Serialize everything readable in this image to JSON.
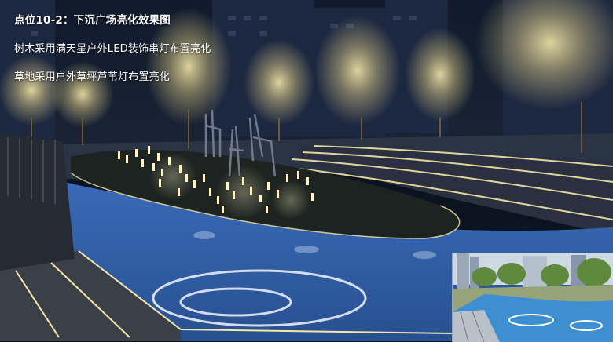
{
  "slide": {
    "title": "点位10-2：下沉广场亮化效果图",
    "lines": [
      "树木采用满天星户外LED装饰串灯布置亮化",
      "草地采用户外草坪芦苇灯布置亮化"
    ]
  },
  "colors": {
    "sky": "#0e1626",
    "plaza_blue": "#2f5fae",
    "light_warm": "#f6e8a6",
    "inset_sky": "#cfd9e2"
  }
}
